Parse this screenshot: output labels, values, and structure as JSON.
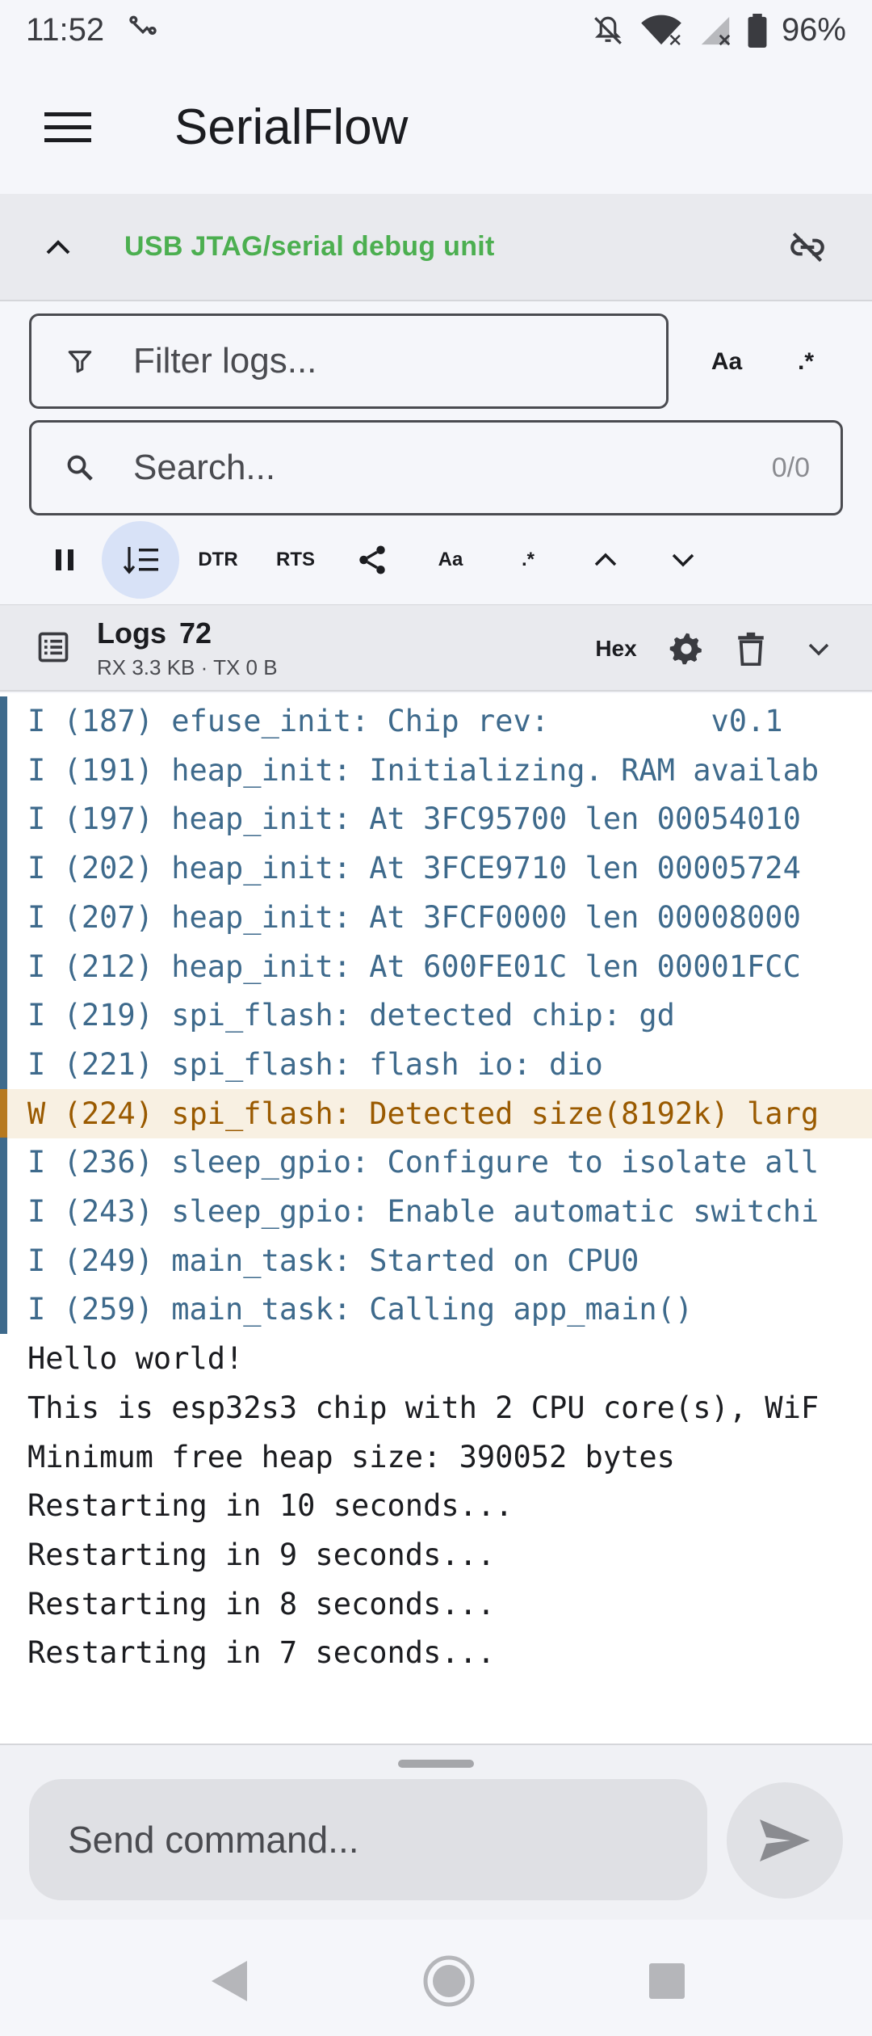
{
  "status_bar": {
    "time": "11:52",
    "battery": "96%",
    "icons": [
      "usb-icon",
      "notifications-off-icon",
      "wifi-icon",
      "cellular-signal-icon",
      "battery-icon"
    ]
  },
  "app_bar": {
    "title": "SerialFlow",
    "menu_icon": "menu-icon"
  },
  "device": {
    "name": "USB JTAG/serial debug unit",
    "name_color": "#4caf50",
    "collapse_icon": "chevron-up-icon",
    "disconnect_icon": "link-off-icon"
  },
  "filter": {
    "placeholder": "Filter logs...",
    "case_label": "Aa",
    "regex_label": ".*"
  },
  "search": {
    "placeholder": "Search...",
    "match_count": "0/0"
  },
  "toolbar": {
    "dtr_label": "DTR",
    "rts_label": "RTS",
    "case_label": "Aa",
    "regex_label": ".*"
  },
  "logs_header": {
    "title": "Logs",
    "count": "72",
    "rx": "RX 3.3 KB",
    "separator": "·",
    "tx": "TX 0 B",
    "hex_label": "Hex"
  },
  "log_lines": [
    {
      "level": "info",
      "text": "I (187) efuse_init: Chip rev:         v0.1"
    },
    {
      "level": "info",
      "text": "I (191) heap_init: Initializing. RAM availab"
    },
    {
      "level": "info",
      "text": "I (197) heap_init: At 3FC95700 len 00054010"
    },
    {
      "level": "info",
      "text": "I (202) heap_init: At 3FCE9710 len 00005724"
    },
    {
      "level": "info",
      "text": "I (207) heap_init: At 3FCF0000 len 00008000"
    },
    {
      "level": "info",
      "text": "I (212) heap_init: At 600FE01C len 00001FCC"
    },
    {
      "level": "info",
      "text": "I (219) spi_flash: detected chip: gd"
    },
    {
      "level": "info",
      "text": "I (221) spi_flash: flash io: dio"
    },
    {
      "level": "warn",
      "text": "W (224) spi_flash: Detected size(8192k) larg"
    },
    {
      "level": "info",
      "text": "I (236) sleep_gpio: Configure to isolate all"
    },
    {
      "level": "info",
      "text": "I (243) sleep_gpio: Enable automatic switchi"
    },
    {
      "level": "info",
      "text": "I (249) main_task: Started on CPU0"
    },
    {
      "level": "info",
      "text": "I (259) main_task: Calling app_main()"
    },
    {
      "level": "plain",
      "text": "Hello world!"
    },
    {
      "level": "plain",
      "text": "This is esp32s3 chip with 2 CPU core(s), WiF"
    },
    {
      "level": "plain",
      "text": "Minimum free heap size: 390052 bytes"
    },
    {
      "level": "plain",
      "text": "Restarting in 10 seconds..."
    },
    {
      "level": "plain",
      "text": "Restarting in 9 seconds..."
    },
    {
      "level": "plain",
      "text": "Restarting in 8 seconds..."
    },
    {
      "level": "plain",
      "text": "Restarting in 7 seconds..."
    }
  ],
  "command": {
    "placeholder": "Send command...",
    "send_icon": "send-icon"
  },
  "colors": {
    "accent_connected": "#4caf50",
    "info_log": "#3e6a8c",
    "warn_log": "#9a5a00",
    "autoscroll_active_bg": "#d8e2f7"
  }
}
